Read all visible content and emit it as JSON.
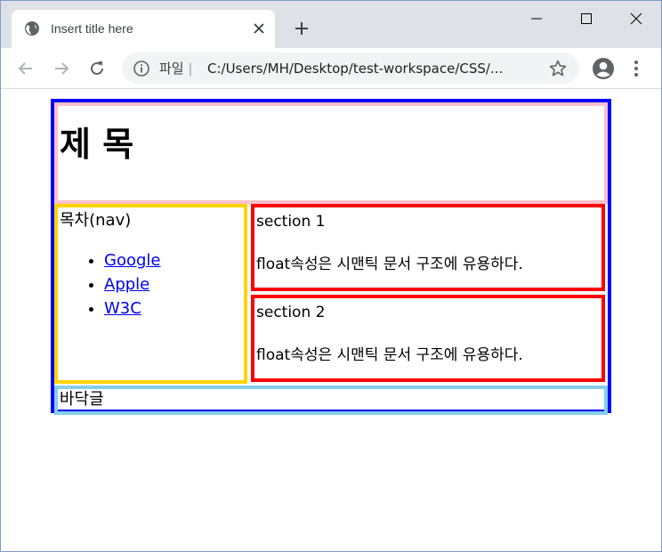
{
  "browser": {
    "tab_title": "Insert title here",
    "scheme_label": "파일",
    "separator": "|",
    "url": "C:/Users/MH/Desktop/test-workspace/CSS/..."
  },
  "page": {
    "header": {
      "title": "제 목",
      "border_color": "#ffc0cb"
    },
    "nav": {
      "title": "목차(nav)",
      "links": [
        "Google",
        "Apple",
        "W3C"
      ],
      "border_color": "#ffd400"
    },
    "sections": [
      {
        "title": "section 1",
        "text": "float속성은 시맨틱 문서 구조에 유용하다."
      },
      {
        "title": "section 2",
        "text": "float속성은 시맨틱 문서 구조에 유용하다."
      }
    ],
    "footer": {
      "text": "바닥글",
      "border_color": "#87ceeb"
    },
    "wrapper_border_color": "#0000ff",
    "section_border_color": "#ff0000"
  }
}
